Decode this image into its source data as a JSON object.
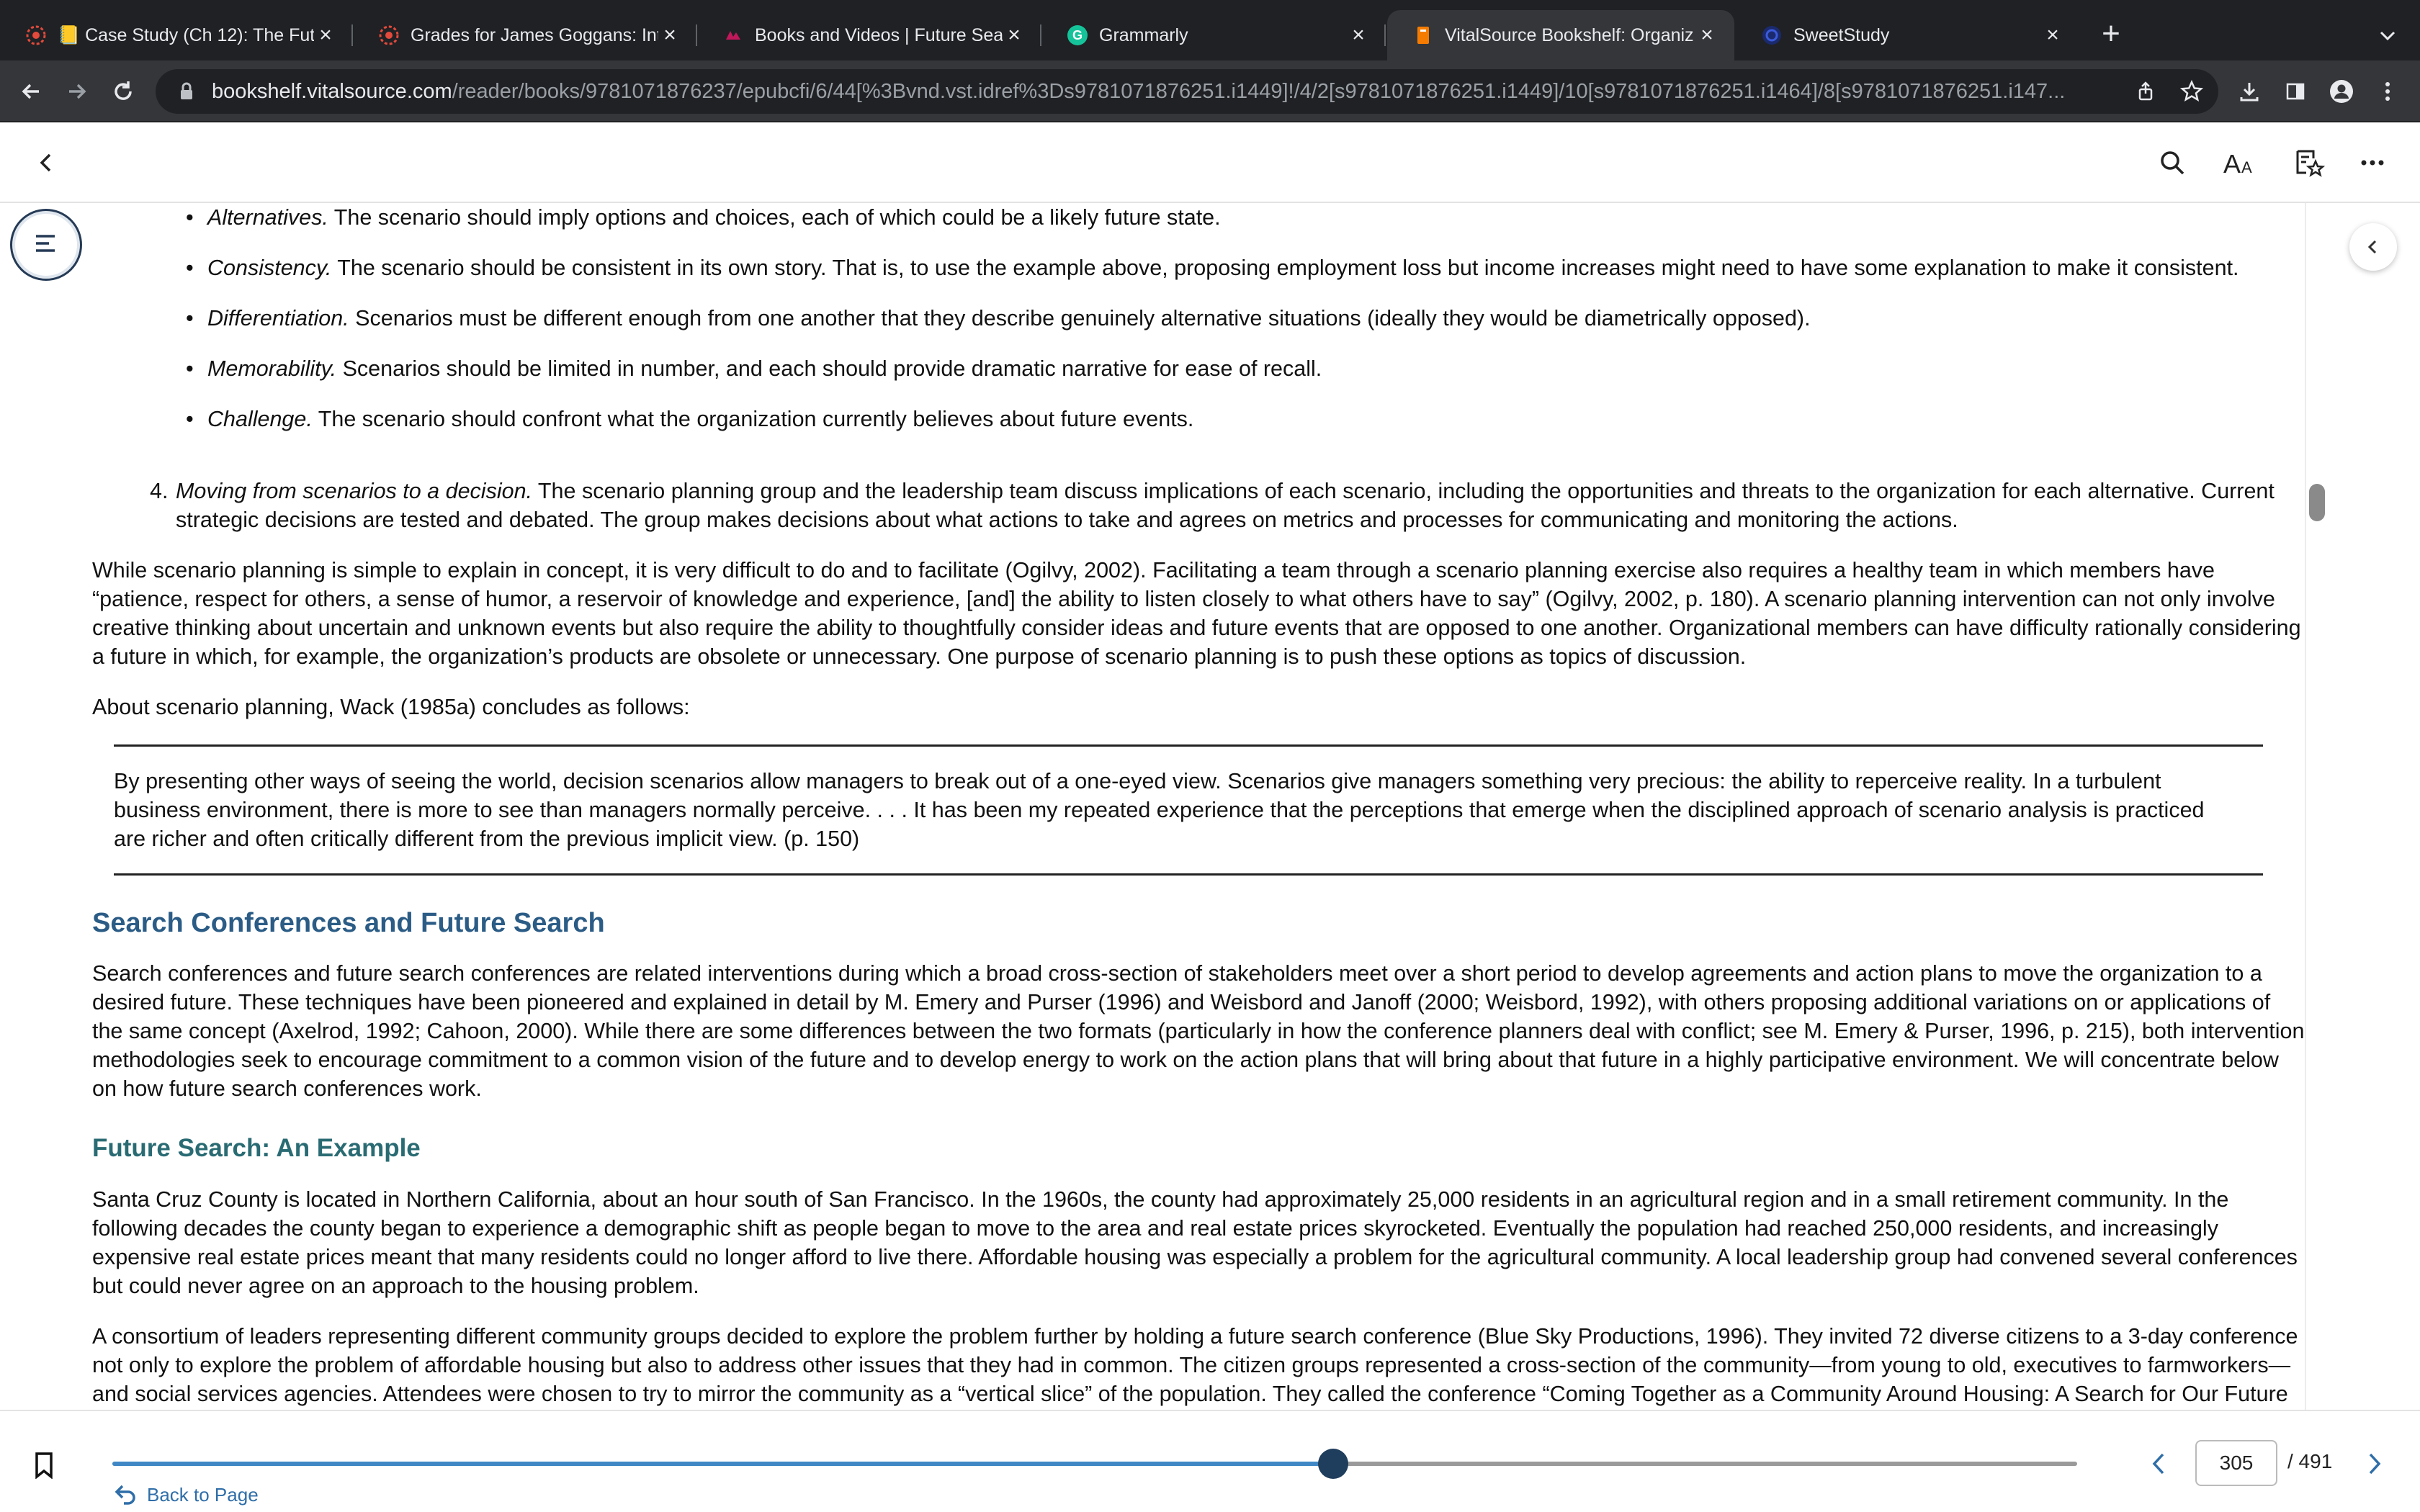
{
  "browser": {
    "tabs": [
      {
        "title": "📒 Case Study (Ch 12): The Fut",
        "icon": "asu-pitchfork-icon",
        "active": false
      },
      {
        "title": "Grades for James Goggans: Int",
        "icon": "asu-pitchfork-icon",
        "active": false
      },
      {
        "title": "Books and Videos | Future Sear",
        "icon": "video-library-icon",
        "active": false
      },
      {
        "title": "Grammarly",
        "icon": "grammarly-icon",
        "active": false
      },
      {
        "title": "VitalSource Bookshelf: Organiz",
        "icon": "vitalsource-icon",
        "active": true
      },
      {
        "title": "SweetStudy",
        "icon": "sweetstudy-icon",
        "active": false
      }
    ],
    "url_host": "bookshelf.vitalsource.com",
    "url_path": "/reader/books/9781071876237/epubcfi/6/44[%3Bvnd.vst.idref%3Ds9781071876251.i1449]!/4/2[s9781071876251.i1449]/10[s9781071876251.i1464]/8[s9781071876251.i147..."
  },
  "reader": {
    "bullets": [
      {
        "term": "Alternatives.",
        "text": " The scenario should imply options and choices, each of which could be a likely future state."
      },
      {
        "term": "Consistency.",
        "text": " The scenario should be consistent in its own story. That is, to use the example above, proposing employment loss but income increases might need to have some explanation to make it consistent."
      },
      {
        "term": "Differentiation.",
        "text": " Scenarios must be different enough from one another that they describe genuinely alternative situations (ideally they would be diametrically opposed)."
      },
      {
        "term": "Memorability.",
        "text": " Scenarios should be limited in number, and each should provide dramatic narrative for ease of recall."
      },
      {
        "term": "Challenge.",
        "text": " The scenario should confront what the organization currently believes about future events."
      }
    ],
    "step4": {
      "number": "4.",
      "term": "Moving from scenarios to a decision.",
      "text": " The scenario planning group and the leadership team discuss implications of each scenario, including the opportunities and threats to the organization for each alternative. Current strategic decisions are tested and debated. The group makes decisions about what actions to take and agrees on metrics and processes for communicating and monitoring the actions."
    },
    "para1": "While scenario planning is simple to explain in concept, it is very difficult to do and to facilitate (Ogilvy, 2002). Facilitating a team through a scenario planning exercise also requires a healthy team in which members have “patience, respect for others, a sense of humor, a reservoir of knowledge and experience, [and] the ability to listen closely to what others have to say” (Ogilvy, 2002, p. 180). A scenario planning intervention can not only involve creative thinking about uncertain and unknown events but also require the ability to thoughtfully consider ideas and future events that are opposed to one another. Organizational members can have difficulty rationally considering a future in which, for example, the organization’s products are obsolete or unnecessary. One purpose of scenario planning is to push these options as topics of discussion.",
    "para2": "About scenario planning, Wack (1985a) concludes as follows:",
    "quote": "By presenting other ways of seeing the world, decision scenarios allow managers to break out of a one-eyed view. Scenarios give managers something very precious: the ability to reperceive reality. In a turbulent business environment, there is more to see than managers normally perceive. . . . It has been my repeated experience that the perceptions that emerge when the disciplined approach of scenario analysis is practiced are richer and often critically different from the previous implicit view. (p. 150)",
    "heading1": "Search Conferences and Future Search",
    "para3": "Search conferences and future search conferences are related interventions during which a broad cross-section of stakeholders meet over a short period to develop agreements and action plans to move the organization to a desired future. These techniques have been pioneered and explained in detail by M. Emery and Purser (1996) and Weisbord and Janoff (2000; Weisbord, 1992), with others proposing additional variations on or applications of the same concept (Axelrod, 1992; Cahoon, 2000). While there are some differences between the two formats (particularly in how the conference planners deal with conflict; see M. Emery & Purser, 1996, p. 215), both intervention methodologies seek to encourage commitment to a common vision of the future and to develop energy to work on the action plans that will bring about that future in a highly participative environment. We will concentrate below on how future search conferences work.",
    "heading2": "Future Search: An Example",
    "para4": "Santa Cruz County is located in Northern California, about an hour south of San Francisco. In the 1960s, the county had approximately 25,000 residents in an agricultural region and in a small retirement community. In the following decades the county began to experience a demographic shift as people began to move to the area and real estate prices skyrocketed. Eventually the population had reached 250,000 residents, and increasingly expensive real estate prices meant that many residents could no longer afford to live there. Affordable housing was especially a problem for the agricultural community. A local leadership group had convened several conferences but could never agree on an approach to the housing problem.",
    "para5": "A consortium of leaders representing different community groups decided to explore the problem further by holding a future search conference (Blue Sky Productions, 1996). They invited 72 diverse citizens to a 3-day conference not only to explore the problem of affordable housing but also to address other issues that they had in common. The citizen groups represented a cross-section of the community—from young to old, executives to farmworkers—and social services agencies. Attendees were chosen to try to mirror the community as a “vertical slice” of the population. They called the conference “Coming Together as a Community Around Housing: A Search for Our Future in Santa Cruz"
  },
  "footer": {
    "back_label": "Back to Page",
    "current_page": "305",
    "total_pages": "/ 491",
    "progress": 0.6212
  },
  "colors": {
    "heading_primary": "#2b5c86",
    "heading_secondary": "#2a6b73",
    "accent": "#3f88c5",
    "thumb": "#1f3d5c"
  }
}
